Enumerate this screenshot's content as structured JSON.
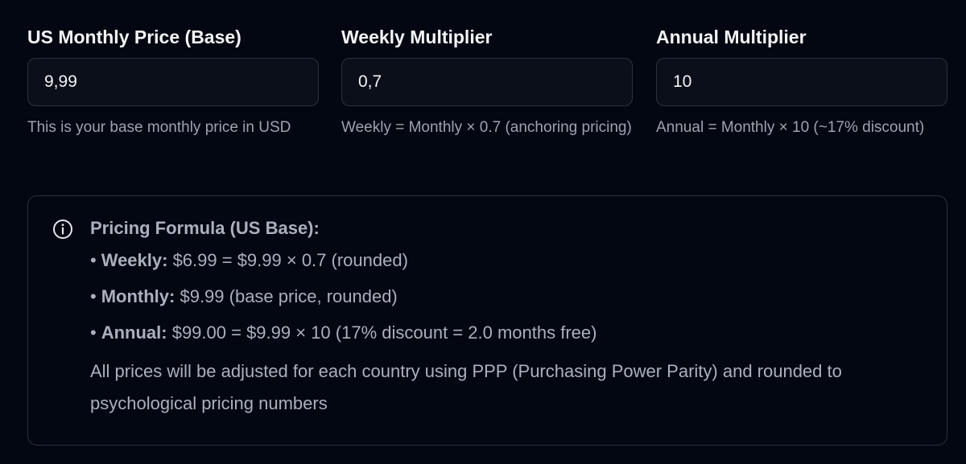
{
  "fields": {
    "monthly": {
      "label": "US Monthly Price (Base)",
      "value": "9,99",
      "help": "This is your base monthly price in USD"
    },
    "weekly": {
      "label": "Weekly Multiplier",
      "value": "0,7",
      "help": "Weekly = Monthly × 0.7 (anchoring pricing)"
    },
    "annual": {
      "label": "Annual Multiplier",
      "value": "10",
      "help": "Annual = Monthly × 10 (~17% discount)"
    }
  },
  "formula": {
    "icon": "info-circle-icon",
    "title": "Pricing Formula (US Base):",
    "bullet": "•",
    "items": [
      {
        "term": "Weekly:",
        "text": " $6.99 = $9.99 × 0.7 (rounded)"
      },
      {
        "term": "Monthly:",
        "text": " $9.99 (base price, rounded)"
      },
      {
        "term": "Annual:",
        "text": " $99.00 = $9.99 × 10 (17% discount = 2.0 months free)"
      }
    ],
    "note": "All prices will be adjusted for each country using PPP (Purchasing Power Parity) and rounded to psychological pricing numbers"
  }
}
